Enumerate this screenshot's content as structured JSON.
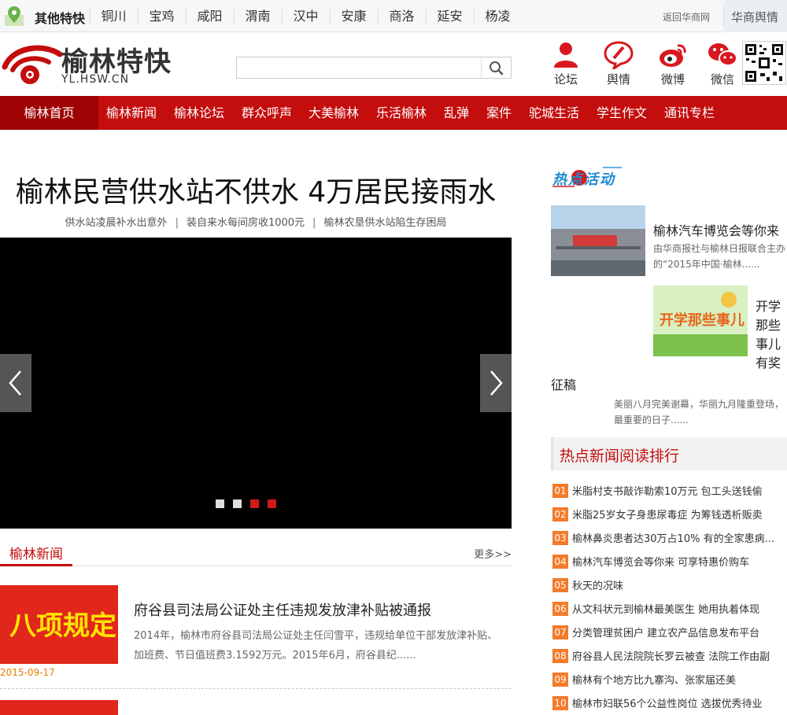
{
  "topbar": {
    "other_label": "其他特快",
    "cities": [
      "铜川",
      "宝鸡",
      "咸阳",
      "渭南",
      "汉中",
      "安康",
      "商洛",
      "延安",
      "杨凌"
    ],
    "back_link": "返回华商网",
    "yuqing_tab": "华商舆情"
  },
  "header": {
    "logo_title": "榆林特快",
    "logo_domain": "YL.HSW.CN",
    "search_value": "",
    "icons": [
      {
        "label": "论坛",
        "icon": "person-icon"
      },
      {
        "label": "舆情",
        "icon": "speech-pen-icon"
      },
      {
        "label": "微博",
        "icon": "weibo-icon"
      },
      {
        "label": "微信",
        "icon": "wechat-icon"
      }
    ]
  },
  "nav": {
    "items": [
      "榆林首页",
      "榆林新闻",
      "榆林论坛",
      "群众呼声",
      "大美榆林",
      "乐活榆林",
      "乱弹",
      "案件",
      "驼城生活",
      "学生作文",
      "通讯专栏"
    ]
  },
  "headline": {
    "title": "榆林民营供水站不供水 4万居民接雨水",
    "subs": [
      "供水站凌晨补水出意外",
      "装自来水每间房收1000元",
      "榆林农垦供水站陷生存困局"
    ]
  },
  "slider": {
    "dots": 4,
    "active_index": 2
  },
  "news_section": {
    "title": "榆林新闻",
    "more": "更多>>",
    "items": [
      {
        "thumb_text": "八项规定",
        "title": "府谷县司法局公证处主任违规发放津补贴被通报",
        "desc": "2014年，榆林市府谷县司法局公证处主任闫雪平，违规给单位干部发放津补贴、加班费、节日值班费3.1592万元。2015年6月，府谷县纪......",
        "date": "2015-09-17"
      }
    ]
  },
  "activities": {
    "logo_text": "热点活动",
    "items": [
      {
        "title": "榆林汽车博览会等你来",
        "desc": "由华商报社与榆林日报联合主办的“2015年中国·榆林......"
      },
      {
        "title_part1": "开学那些事儿有奖",
        "title_part2": "征稿",
        "image_text": "开学那些事儿",
        "desc": "美丽八月完美谢幕，华丽九月隆重登场，最重要的日子......"
      }
    ]
  },
  "ranking": {
    "title": "热点新闻阅读排行",
    "items": [
      {
        "num": "01",
        "text": "米脂村支书敲诈勒索10万元 包工头送钱偷"
      },
      {
        "num": "02",
        "text": "米脂25岁女子身患尿毒症 为筹钱透析贩卖"
      },
      {
        "num": "03",
        "text": "榆林鼻炎患者达30万占10% 有的全家患病..."
      },
      {
        "num": "04",
        "text": "榆林汽车博览会等你来 可享特惠价购车"
      },
      {
        "num": "05",
        "text": "秋天的况味"
      },
      {
        "num": "06",
        "text": "从文科状元到榆林最美医生 她用执着体现"
      },
      {
        "num": "07",
        "text": "分类管理贫困户 建立农产品信息发布平台"
      },
      {
        "num": "08",
        "text": "府谷县人民法院院长罗云被查 法院工作由副"
      },
      {
        "num": "09",
        "text": "榆林有个地方比九寨沟、张家届还美"
      },
      {
        "num": "10",
        "text": "榆林市妇联56个公益性岗位 选拔优秀待业"
      }
    ]
  },
  "colors": {
    "brand_red": "#c40d0d",
    "nav_home": "#9e0202",
    "rank_badge": "#f37b2b"
  }
}
